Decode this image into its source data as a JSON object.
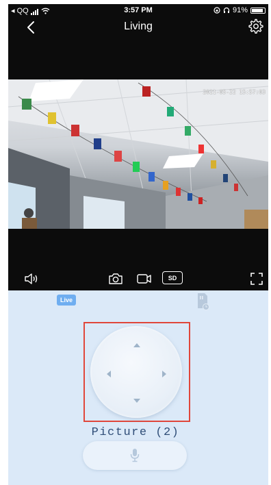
{
  "status_bar": {
    "carrier": "◂ QQ",
    "time": "3:57 PM",
    "battery": "91%",
    "battery_level": 0.91
  },
  "nav": {
    "title": "Living"
  },
  "video": {
    "timestamp": "2021-05-22 15:57:03"
  },
  "controls": {
    "sd_label": "SD"
  },
  "panel": {
    "live_label": "Live",
    "picture_label": "Picture (2)"
  },
  "colors": {
    "panel_bg": "#dbe9f8",
    "live_badge": "#6faef0",
    "highlight": "#e0463a",
    "picture_text": "#304e78"
  }
}
